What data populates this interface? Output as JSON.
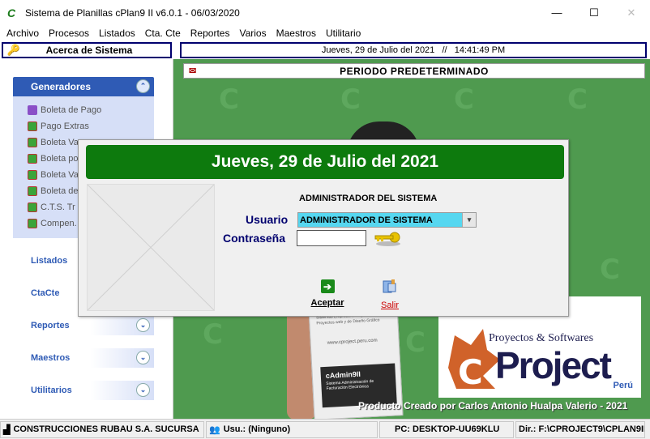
{
  "window": {
    "title": "Sistema de Planillas cPlan9 II v6.0.1 - 06/03/2020",
    "minimize": "—",
    "maximize": "☐",
    "close": "✕"
  },
  "menu": [
    "Archivo",
    "Procesos",
    "Listados",
    "Cta. Cte",
    "Reportes",
    "Varios",
    "Maestros",
    "Utilitario"
  ],
  "toolbar": {
    "about_label": "Acerca de Sistema",
    "datetime": "Jueves, 29 de Julio del 2021   //   14:41:49 PM"
  },
  "period": "PERIODO PREDETERMINADO",
  "sidebar": {
    "generators_title": "Generadores",
    "generators": [
      {
        "label": "Boleta de Pago",
        "icon": "purple"
      },
      {
        "label": "Pago Extras",
        "icon": "green"
      },
      {
        "label": "Boleta Va",
        "icon": "green"
      },
      {
        "label": "Boleta po",
        "icon": "green"
      },
      {
        "label": "Boleta Va",
        "icon": "green"
      },
      {
        "label": "Boleta de",
        "icon": "green"
      },
      {
        "label": "C.T.S. Tr",
        "icon": "green"
      },
      {
        "label": "Compen.",
        "icon": "green"
      }
    ],
    "links": [
      {
        "label": "Listados",
        "expandable": false
      },
      {
        "label": "CtaCte",
        "expandable": false
      },
      {
        "label": "Reportes",
        "expandable": true
      },
      {
        "label": "Maestros",
        "expandable": true
      },
      {
        "label": "Utilitarios",
        "expandable": true
      }
    ]
  },
  "dialog": {
    "banner": "Jueves, 29 de Julio del 2021",
    "heading": "ADMINISTRADOR DEL SISTEMA",
    "user_label": "Usuario",
    "user_value": "ADMINISTRADOR DE SISTEMA",
    "password_label": "Contraseña",
    "password_value": "",
    "accept_label": "Aceptar",
    "exit_label": "Salir"
  },
  "brand": {
    "tagline": "Proyectos & Softwares",
    "name": "Project",
    "country": "Perú",
    "credit": "Producto Creado por Carlos Antonio Hualpa Valerio - 2021"
  },
  "phone": {
    "text_top": "Sistemas Empresariales y Contables\nProyectos web y de Diseño Gráfico",
    "url": "www.cproject.peru.com",
    "app": "cAdmin9II",
    "app_sub": "Sistema Administración de Facturación Electrónica"
  },
  "status": {
    "company": "CONSTRUCCIONES RUBAU S.A. SUCURSA",
    "user": "Usu.: (Ninguno)",
    "pc": "PC: DESKTOP-UU69KLU",
    "dir": "Dir.: F:\\CPROJECT9\\CPLAN9II"
  },
  "colors": {
    "accent_navy": "#00006e",
    "sidebar_blue": "#2f5bb5",
    "banner_green": "#0d7a0d",
    "background_green": "#4f9a4f",
    "input_cyan": "#56d7f0"
  }
}
